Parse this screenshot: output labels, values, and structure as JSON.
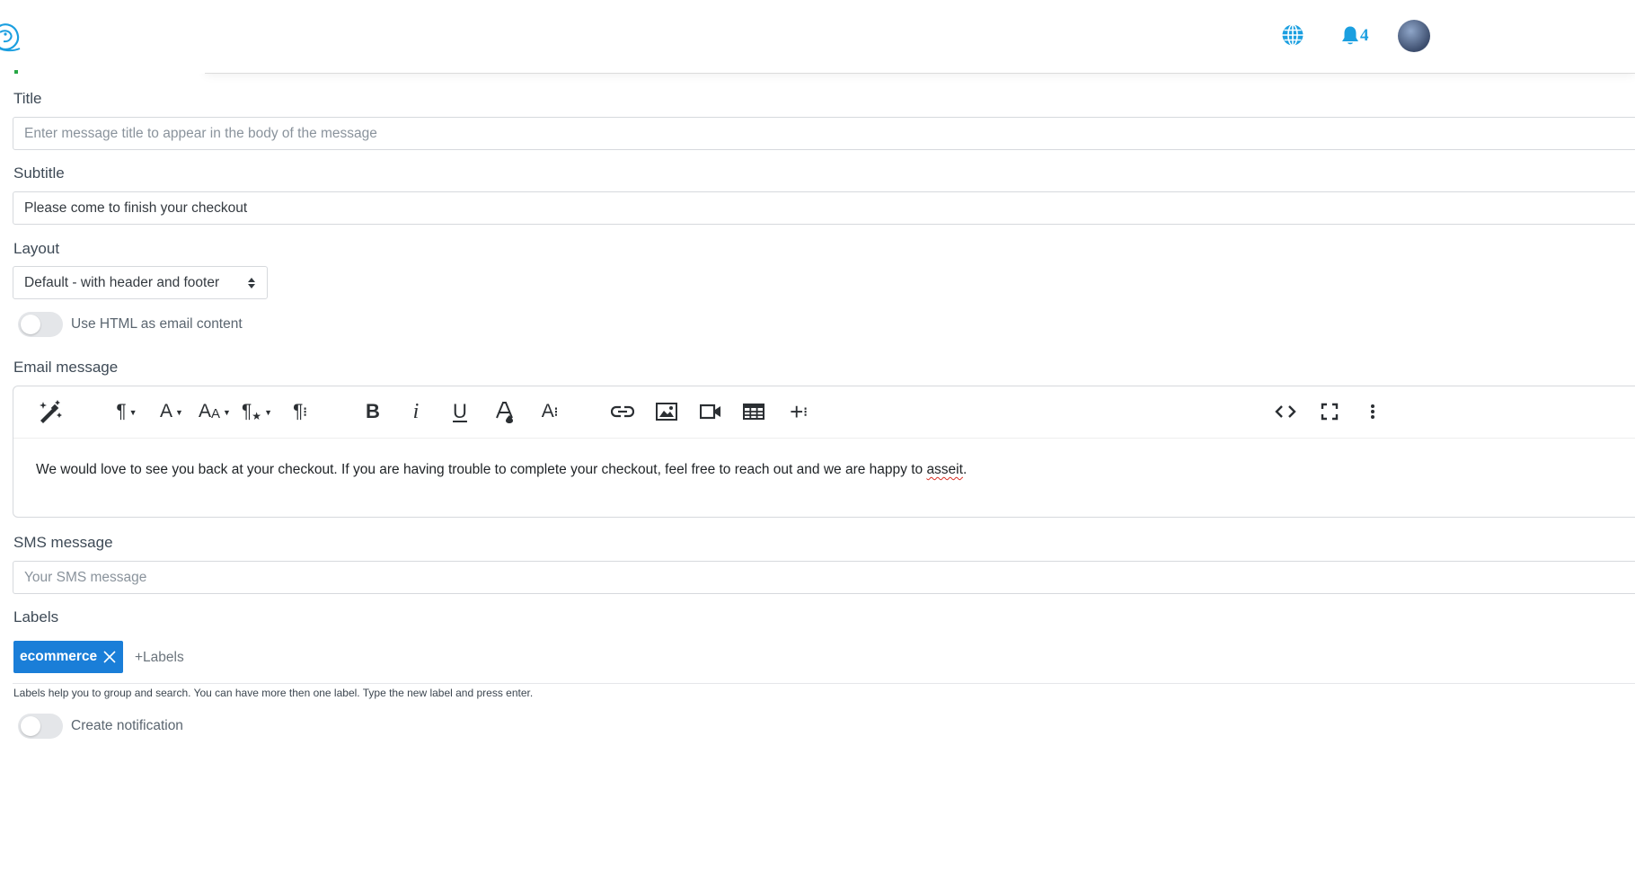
{
  "header": {
    "logo_icon": "dolphin-logo-icon",
    "globe_icon": "globe-icon",
    "bell_icon": "bell-icon",
    "notification_count": "4",
    "accent_color": "#1b9fe0"
  },
  "form": {
    "title": {
      "label": "Title",
      "value": "",
      "placeholder": "Enter message title to appear in the body of the message"
    },
    "subtitle": {
      "label": "Subtitle",
      "value": "Please come to finish your checkout",
      "placeholder": ""
    },
    "layout": {
      "label": "Layout",
      "selected": "Default - with header and footer"
    },
    "html_toggle": {
      "label": "Use HTML as email content",
      "on": false
    },
    "email": {
      "label": "Email message",
      "body_text": "We would love to see you back at your checkout. If you are having trouble to complete your checkout, feel free to reach out and we are happy to ",
      "body_misspelled": "asseit",
      "body_end": ".",
      "toolbar": {
        "magic": "magic-wand-icon",
        "paragraph_format": "paragraph-format-icon",
        "font_family": "font-family-icon",
        "font_size": "font-size-icon",
        "paragraph_style": "paragraph-style-icon",
        "more_paragraph": "more-paragraph-icon",
        "bold": "B",
        "italic": "i",
        "underline": "U",
        "text_color": "text-color-icon",
        "more_text": "more-text-icon",
        "link": "link-icon",
        "image": "image-icon",
        "video": "video-icon",
        "table": "table-icon",
        "more_insert": "more-insert-icon",
        "code_view": "code-view-icon",
        "fullscreen": "fullscreen-icon",
        "more": "more-vertical-icon"
      }
    },
    "sms": {
      "label": "SMS message",
      "value": "",
      "placeholder": "Your SMS message"
    },
    "labels": {
      "label": "Labels",
      "chips": [
        "ecommerce"
      ],
      "input_text": "+Labels",
      "chip_color": "#1a7ed8",
      "help": "Labels help you to group and search. You can have more then one label. Type the new label and press enter."
    },
    "notification_toggle": {
      "label": "Create notification",
      "on": false
    }
  }
}
